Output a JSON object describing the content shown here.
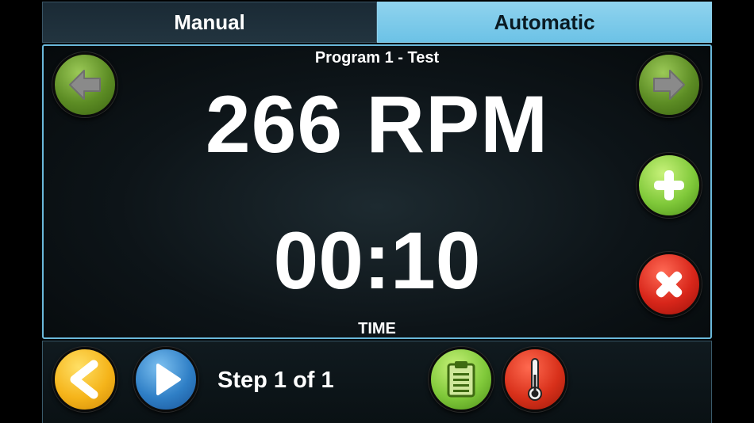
{
  "tabs": {
    "manual": "Manual",
    "automatic": "Automatic",
    "selected": "Automatic"
  },
  "display": {
    "program_name": "Program 1 - Test",
    "rpm": "266 RPM",
    "time": "00:10",
    "time_label": "TIME"
  },
  "footer": {
    "step_label": "Step 1 of 1"
  },
  "icons": {
    "prev_program": "arrow-left-icon",
    "next_program": "arrow-right-icon",
    "add": "plus-icon",
    "delete": "close-icon",
    "back": "chevron-left-icon",
    "play": "play-icon",
    "program_list": "clipboard-icon",
    "temperature": "thermometer-icon"
  },
  "colors": {
    "tab_active": "#8fd3ee",
    "panel_border": "#6ab8da",
    "green_button": "#80c93a",
    "red_button": "#d8261a",
    "yellow_button": "#f5b41a",
    "blue_button": "#2f7fc6"
  }
}
